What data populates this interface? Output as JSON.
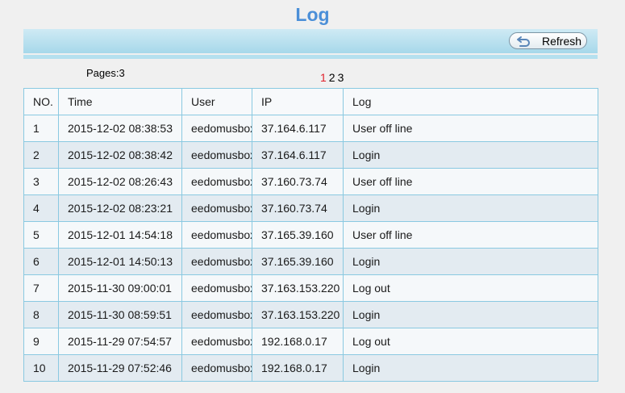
{
  "page_title": "Log",
  "toolbar": {
    "refresh_label": "Refresh",
    "refresh_icon": "undo-arrow-icon"
  },
  "pagination": {
    "pages_text": "Pages:3",
    "pages": [
      "1",
      "2",
      "3"
    ],
    "current_page": "1",
    "active_color": "#e0202a"
  },
  "table": {
    "headers": [
      "NO.",
      "Time",
      "User",
      "IP",
      "Log"
    ],
    "rows": [
      [
        "1",
        "2015-12-02 08:38:53",
        "eedomusbox",
        "37.164.6.117",
        "User off line"
      ],
      [
        "2",
        "2015-12-02 08:38:42",
        "eedomusbox",
        "37.164.6.117",
        "Login"
      ],
      [
        "3",
        "2015-12-02 08:26:43",
        "eedomusbox",
        "37.160.73.74",
        "User off line"
      ],
      [
        "4",
        "2015-12-02 08:23:21",
        "eedomusbox",
        "37.160.73.74",
        "Login"
      ],
      [
        "5",
        "2015-12-01 14:54:18",
        "eedomusbox",
        "37.165.39.160",
        "User off line"
      ],
      [
        "6",
        "2015-12-01 14:50:13",
        "eedomusbox",
        "37.165.39.160",
        "Login"
      ],
      [
        "7",
        "2015-11-30 09:00:01",
        "eedomusbox",
        "37.163.153.220",
        "Log out"
      ],
      [
        "8",
        "2015-11-30 08:59:51",
        "eedomusbox",
        "37.163.153.220",
        "Login"
      ],
      [
        "9",
        "2015-11-29 07:54:57",
        "eedomusbox",
        "192.168.0.17",
        "Log out"
      ],
      [
        "10",
        "2015-11-29 07:52:46",
        "eedomusbox",
        "192.168.0.17",
        "Login"
      ]
    ]
  },
  "colors": {
    "title": "#4b8fd8",
    "toolbar": "#a6d8ea",
    "table_border": "#8ac9e1",
    "row_alt": "#e3ebf1"
  }
}
